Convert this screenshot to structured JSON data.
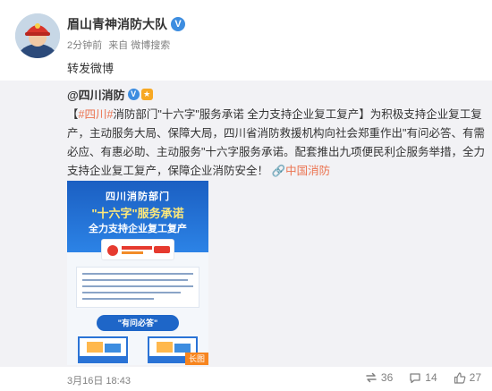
{
  "post": {
    "author": "眉山青神消防大队",
    "time": "2分钟前",
    "source": "来自 微博搜索",
    "text": "转发微博"
  },
  "repost": {
    "author": "@四川消防",
    "text_prefix": "【",
    "hashtag": "#四川#",
    "text_main": "消防部门\"十六字\"服务承诺 全力支持企业复工复产】为积极支持企业复工复产，主动服务大局、保障大局，四川省消防救援机构向社会郑重作出\"有问必答、有需必应、有惠必助、主动服务\"十六字服务承诺。配套推出九项便民利企服务举措，全力支持企业复工复产，保障企业消防安全！",
    "link_text": "中国消防",
    "image": {
      "line1": "四川消防部门",
      "line2": "\"十六字\"服务承诺",
      "line3": "全力支持企业复工复产",
      "pill": "\"有问必答\"",
      "long_label": "长图"
    },
    "date": "3月16日 18:43"
  },
  "actions": {
    "repost_count": "36",
    "comment_count": "14",
    "like_count": "27"
  },
  "colors": {
    "accent": "#eb7350",
    "verified": "#3d8de0",
    "repost_bg": "#f2f2f5"
  }
}
